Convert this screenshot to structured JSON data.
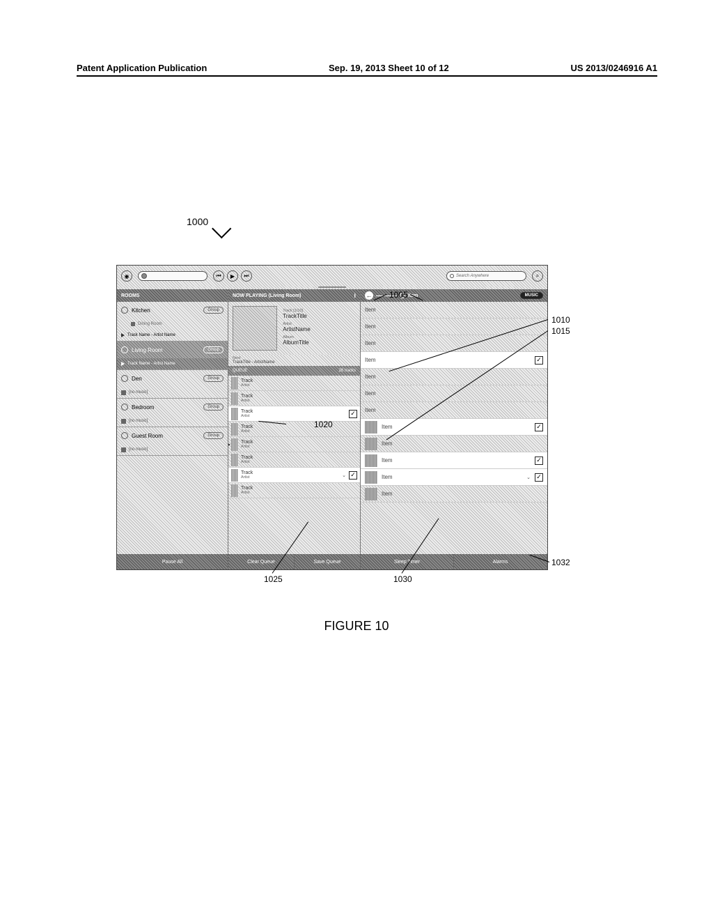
{
  "page_header": {
    "left": "Patent Application Publication",
    "mid": "Sep. 19, 2013  Sheet 10 of 12",
    "right": "US 2013/0246916 A1"
  },
  "fig_ref_main": "1000",
  "figure_caption": "FIGURE 10",
  "callouts": {
    "c1005": "1005",
    "c1010": "1010",
    "c1015": "1015",
    "c1020": "1020",
    "c1025": "1025",
    "c1030": "1030",
    "c1032": "1032"
  },
  "topbar": {
    "search_placeholder": "Search Anywhere"
  },
  "rooms": {
    "header": "ROOMS",
    "group_btn": "Group",
    "track_line": "Track Name - Artist Name",
    "no_music": "[no music]",
    "items": [
      {
        "name": "Kitchen",
        "sub": "Dining Room",
        "has_track": true,
        "active": false
      },
      {
        "name": "Living Room",
        "has_track": true,
        "active": true
      },
      {
        "name": "Den",
        "no_music": true
      },
      {
        "name": "Bedroom",
        "no_music": true
      },
      {
        "name": "Guest Room",
        "no_music": true
      }
    ]
  },
  "now_playing": {
    "header": "NOW PLAYING (Living Room)",
    "track_count_lbl": "Track [1/10]",
    "track_title_lbl": "TrackTitle",
    "artist_lbl": "Artist",
    "artist_val": "ArtistName",
    "album_lbl": "Album",
    "album_val": "AlbumTitle",
    "next_lbl": "Next",
    "next_val": "TrackTitle - ArtistName"
  },
  "queue": {
    "header": "QUEUE",
    "count": "26 tracks",
    "track_label": "Track",
    "artist_label": "Artist",
    "rows": [
      {
        "selected": false
      },
      {
        "selected": false
      },
      {
        "selected": true,
        "checkbox": true
      },
      {
        "selected": false
      },
      {
        "selected": false,
        "playing": true
      },
      {
        "selected": false
      },
      {
        "selected": true,
        "checkbox": true,
        "chev": true
      },
      {
        "selected": false
      }
    ]
  },
  "music": {
    "crumb": "Item",
    "badge": "MUSIC",
    "item_label": "Item",
    "rows": [
      {
        "thumb": false,
        "selected": false
      },
      {
        "thumb": false,
        "selected": false
      },
      {
        "thumb": false,
        "selected": false
      },
      {
        "thumb": false,
        "selected": true,
        "checkbox": true
      },
      {
        "thumb": false,
        "selected": false
      },
      {
        "thumb": false,
        "selected": false
      },
      {
        "thumb": false,
        "selected": false
      },
      {
        "thumb": true,
        "selected": true,
        "checkbox": true
      },
      {
        "thumb": true,
        "selected": false
      },
      {
        "thumb": true,
        "selected": true,
        "checkbox": true
      },
      {
        "thumb": true,
        "selected": true,
        "checkbox": true,
        "chev": true
      },
      {
        "thumb": true,
        "selected": false
      }
    ]
  },
  "footer": {
    "pause_all": "Pause All",
    "clear_queue": "Clear Queue",
    "save_queue": "Save Queue",
    "sleep_timer": "Sleep Timer",
    "alarms": "Alarms"
  }
}
